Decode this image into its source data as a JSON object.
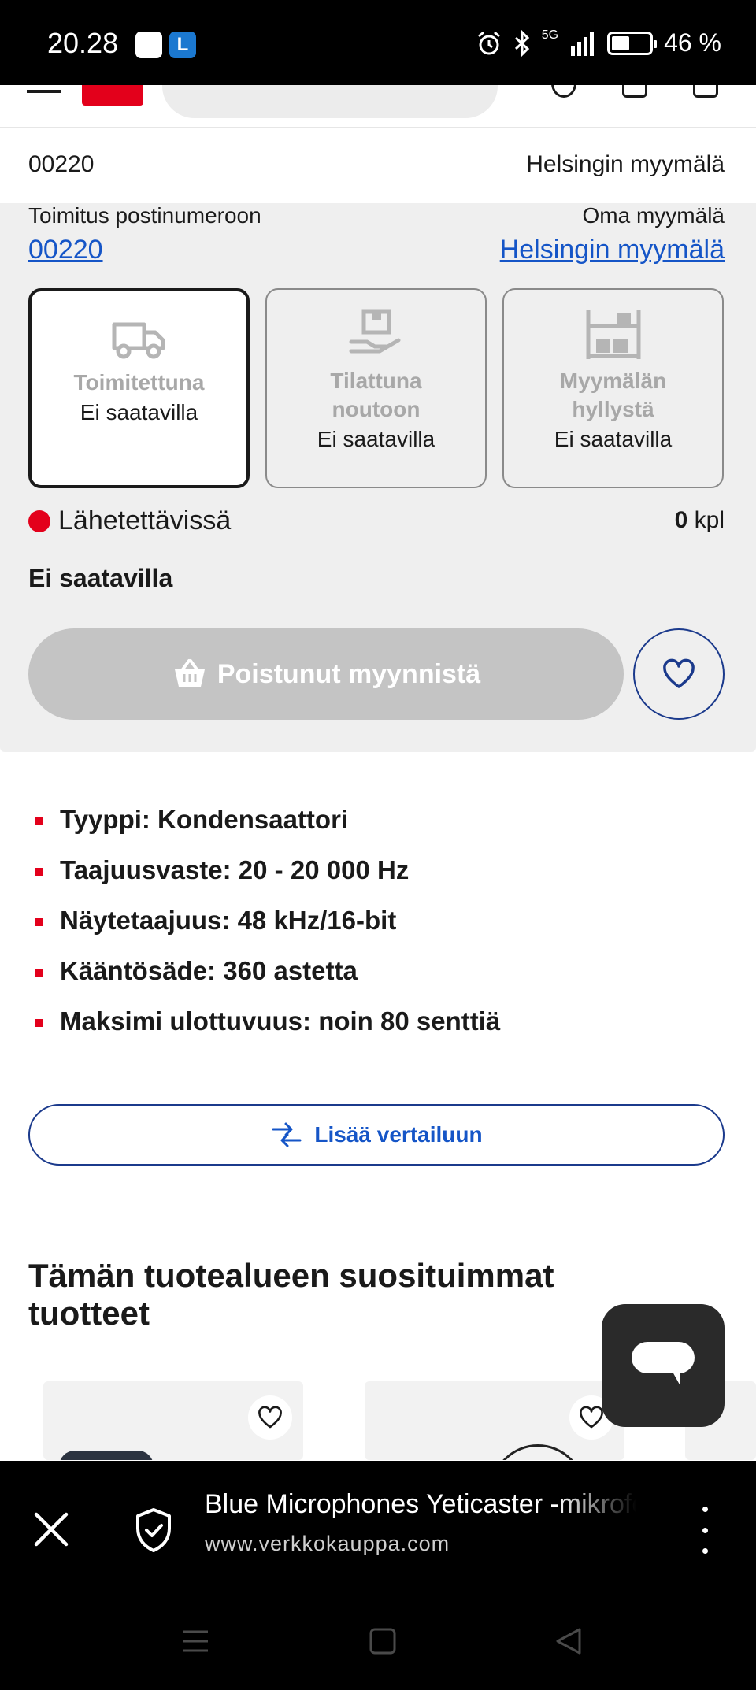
{
  "status_bar": {
    "time": "20.28",
    "network": "5G",
    "battery": "46 %"
  },
  "location": {
    "postal_code": "00220",
    "store": "Helsingin myymälä"
  },
  "delivery": {
    "postal_label": "Toimitus postinumeroon",
    "postal_link": "00220",
    "store_label": "Oma myymälä",
    "store_link": "Helsingin myymälä",
    "options": [
      {
        "title": "Toimitettuna",
        "status": "Ei saatavilla",
        "icon": "truck-icon",
        "selected": true
      },
      {
        "title": "Tilattuna noutoon",
        "status": "Ei saatavilla",
        "icon": "pickup-hand-icon",
        "selected": false
      },
      {
        "title": "Myymälän hyllystä",
        "status": "Ei saatavilla",
        "icon": "shelf-icon",
        "selected": false
      }
    ],
    "shipping_label": "Lähetettävissä",
    "shipping_qty": "0",
    "shipping_unit": "kpl",
    "availability": "Ei saatavilla",
    "cart_button": "Poistunut myynnistä"
  },
  "specs": [
    "Tyyppi: Kondensaattori",
    "Taajuusvaste: 20 - 20 000 Hz",
    "Näytetaajuus: 48 kHz/16-bit",
    "Kääntösäde: 360 astetta",
    "Maksimi ulottuvuus: noin 80 senttiä"
  ],
  "compare_button": "Lisää vertailuun",
  "popular_section_title": "Tämän tuotealueen suosituimmat tuotteet",
  "browser": {
    "page_title": "Blue Microphones Yeticaster -mikrofoni",
    "url": "www.verkkokauppa.com"
  },
  "colors": {
    "brand_red": "#e3001b",
    "link_blue": "#1555c7",
    "panel_gray": "#efefef"
  }
}
